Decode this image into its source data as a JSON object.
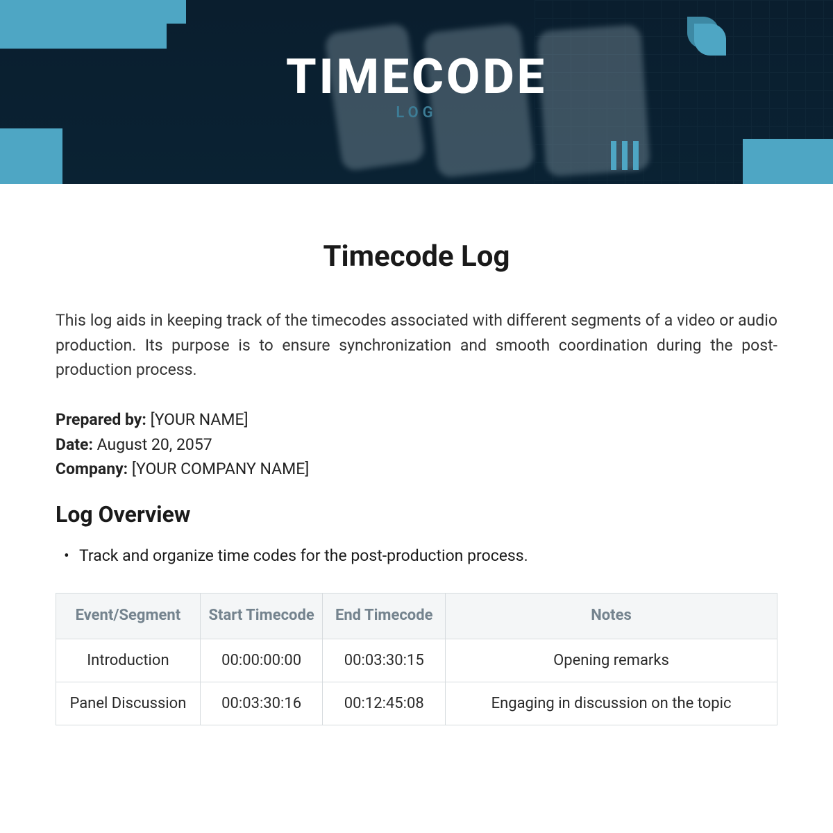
{
  "hero": {
    "title": "TIMECODE",
    "subtitle": "LOG"
  },
  "doc": {
    "title": "Timecode Log",
    "intro": "This log aids in keeping track of the timecodes associated with different segments of a video or audio production. Its purpose is to ensure synchronization and smooth coordination during the post-production process.",
    "meta": {
      "prepared_by_label": "Prepared by:",
      "prepared_by_value": "[YOUR NAME]",
      "date_label": "Date:",
      "date_value": "August 20, 2057",
      "company_label": "Company:",
      "company_value": "[YOUR COMPANY NAME]"
    },
    "overview_heading": "Log Overview",
    "overview_bullet": "Track and organize time codes for the post-production process."
  },
  "table": {
    "headers": {
      "event": "Event/Segment",
      "start": "Start Timecode",
      "end": "End Timecode",
      "notes": "Notes"
    },
    "rows": [
      {
        "event": "Introduction",
        "start": "00:00:00:00",
        "end": "00:03:30:15",
        "notes": "Opening remarks"
      },
      {
        "event": "Panel Discussion",
        "start": "00:03:30:16",
        "end": "00:12:45:08",
        "notes": "Engaging in discussion on the topic"
      }
    ]
  }
}
